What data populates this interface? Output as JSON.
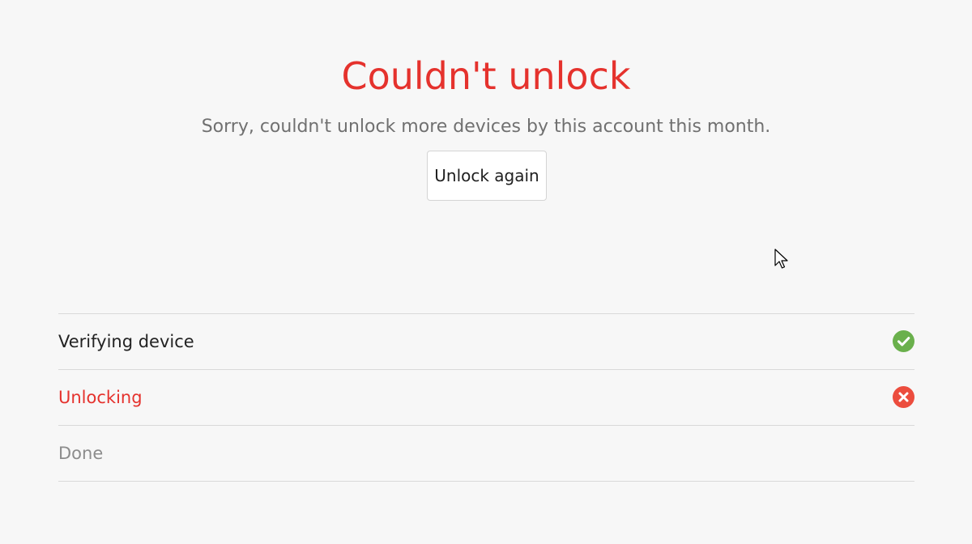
{
  "header": {
    "title": "Couldn't unlock",
    "message": "Sorry, couldn't unlock more devices by this account this month.",
    "retry_label": "Unlock again"
  },
  "colors": {
    "error": "#e5322d",
    "success": "#6ab04c",
    "muted": "#8c8c8c"
  },
  "steps": [
    {
      "label": "Verifying device",
      "status": "done",
      "icon": "check-circle-icon"
    },
    {
      "label": "Unlocking",
      "status": "failed",
      "icon": "error-circle-icon"
    },
    {
      "label": "Done",
      "status": "pending",
      "icon": ""
    }
  ]
}
